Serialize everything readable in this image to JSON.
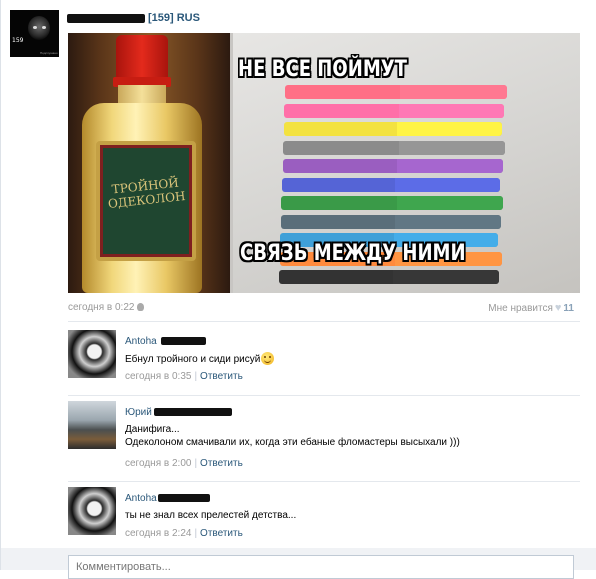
{
  "post": {
    "group_name": "[159] RUS",
    "avatar_number": "159",
    "avatar_caption": "Подслушано",
    "image": {
      "bottle_label": "ТРОЙНОЙ ОДЕКОЛОН",
      "meme_top": "НЕ ВСЕ ПОЙМУТ",
      "meme_bottom": "СВЯЗЬ МЕЖДУ НИМИ",
      "marker_colors": [
        "#ff6f86",
        "#ff6fa8",
        "#f3e240",
        "#8b8b8b",
        "#9a5ec0",
        "#5564d6",
        "#3a9a48",
        "#5a6e7a",
        "#3fa0d8",
        "#ff8a3d",
        "#333333"
      ]
    },
    "timestamp": "сегодня в 0:22",
    "like_label": "Мне нравится",
    "like_count": "11"
  },
  "comments": [
    {
      "author": "Antoha",
      "text": "Ебнул тройного и сиди рисуй",
      "emoji": "smile-emoji",
      "time": "сегодня в 0:35",
      "reply_label": "Ответить"
    },
    {
      "author": "Юрий",
      "text_line1": "Данифига...",
      "text_line2": "Одеколоном смачивали их, когда эти ебаные фломастеры высыхали )))",
      "time": "сегодня в 2:00",
      "reply_label": "Ответить"
    },
    {
      "author": "Antoha",
      "text": "ты не знал всех прелестей детства...",
      "time": "сегодня в 2:24",
      "reply_label": "Ответить"
    }
  ],
  "comment_input": {
    "placeholder": "Комментировать..."
  },
  "colors": {
    "link": "#2b587a",
    "meta": "#999999",
    "separator": "#e4e8ed"
  }
}
